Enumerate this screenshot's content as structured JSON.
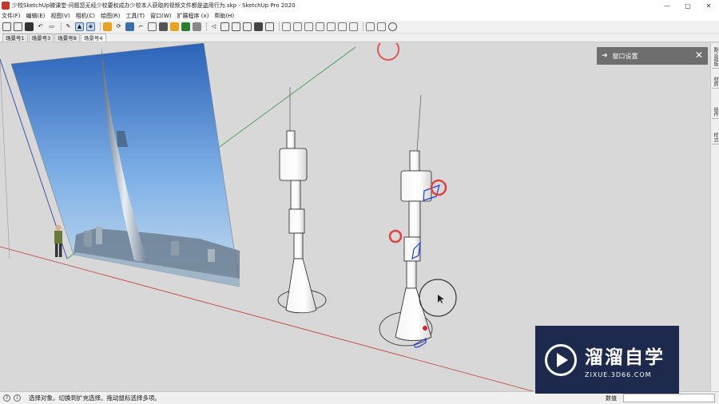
{
  "window": {
    "title": "少校SketchUp微课堂-问题您无经少校要权成办少校本人获取的视频文件都是盗用行为.skp - SketchUp Pro 2020",
    "minimize_glyph": "—",
    "maximize_glyph": "□",
    "close_glyph": "✕"
  },
  "menu": [
    "文件(F)",
    "编辑(E)",
    "视图(V)",
    "相机(C)",
    "绘图(R)",
    "工具(T)",
    "窗口(W)",
    "扩展程序 (x)",
    "帮助(H)"
  ],
  "scene_tabs": [
    "场景号1",
    "场景号3",
    "场景号8",
    "场景号4"
  ],
  "tray": {
    "title": "窗口设置",
    "pin_glyph": "➜",
    "close_glyph": "✕"
  },
  "right_tabs": [
    "默认面板",
    "材质",
    "组件",
    "样式"
  ],
  "status": {
    "text": "选择对象。切换到扩充选择。拖动鼠标选择多项。",
    "measure_label": "数值",
    "info_glyph": "i",
    "help_glyph": "?"
  },
  "watermark": {
    "name": "溜溜自学",
    "url": "ZIXUE.3D66.COM"
  },
  "colors": {
    "accent_red": "#e04040",
    "axis_red": "#c0392b",
    "axis_green": "#2e9d3e",
    "axis_blue": "#2233aa",
    "watermark_bg": "#1d2a4e"
  }
}
